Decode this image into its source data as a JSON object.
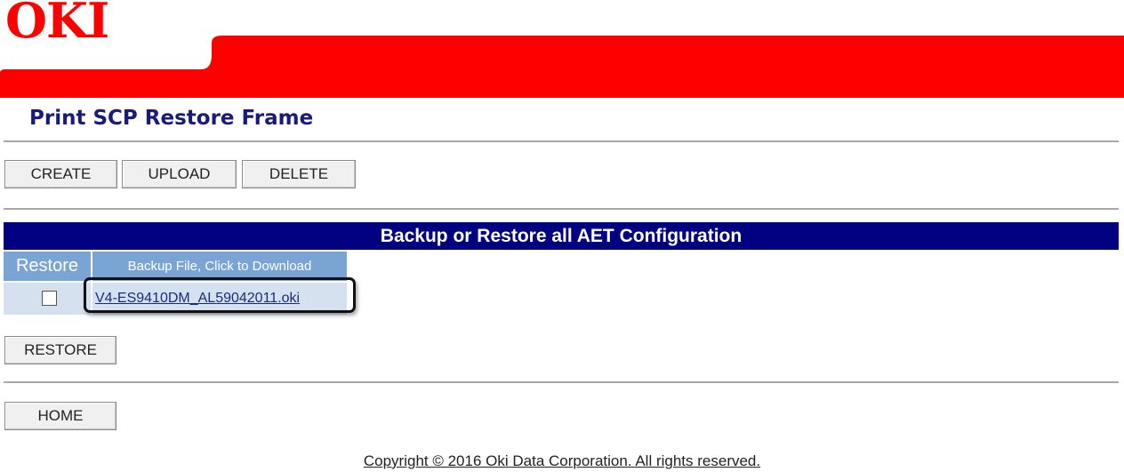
{
  "brand": {
    "logo_text": "OKI",
    "accent_color": "#ff0000",
    "title_color": "#1a1a7a"
  },
  "page": {
    "title": "Print SCP Restore Frame"
  },
  "toolbar": {
    "create_label": "CREATE",
    "upload_label": "UPLOAD",
    "delete_label": "DELETE"
  },
  "section": {
    "title": "Backup or Restore all AET Configuration",
    "bar_color": "#000080",
    "columns": [
      "Restore",
      "Backup File, Click to Download"
    ],
    "rows": [
      {
        "restore_checked": false,
        "file": "V4-ES9410DM_AL59042011.oki"
      }
    ]
  },
  "actions": {
    "restore_label": "RESTORE",
    "home_label": "HOME"
  },
  "footer": {
    "copyright": "Copyright © 2016 Oki Data Corporation. All rights reserved."
  }
}
